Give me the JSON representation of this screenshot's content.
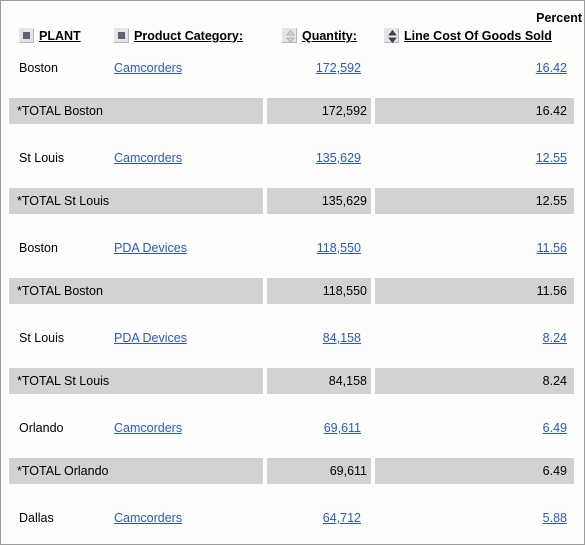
{
  "header": {
    "percent_prefix": "Percent",
    "columns": [
      {
        "label": "PLANT",
        "icon": "group-square-icon",
        "icon_type": "square"
      },
      {
        "label": "Product Category:",
        "icon": "group-square-icon",
        "icon_type": "square"
      },
      {
        "label": "Quantity:",
        "icon": "sort-updown-icon",
        "icon_type": "sort-light"
      },
      {
        "label": "Line Cost Of Goods Sold",
        "icon": "sort-updown-icon",
        "icon_type": "sort-dark"
      }
    ]
  },
  "rows": [
    {
      "type": "detail",
      "plant": "Boston",
      "category": "Camcorders",
      "quantity": "172,592",
      "percent": "16.42"
    },
    {
      "type": "total",
      "label": "*TOTAL Boston",
      "quantity": "172,592",
      "percent": "16.42"
    },
    {
      "type": "detail",
      "plant": "St Louis",
      "category": "Camcorders",
      "quantity": "135,629",
      "percent": "12.55"
    },
    {
      "type": "total",
      "label": "*TOTAL St Louis",
      "quantity": "135,629",
      "percent": "12.55"
    },
    {
      "type": "detail",
      "plant": "Boston",
      "category": "PDA Devices",
      "quantity": "118,550",
      "percent": "11.56"
    },
    {
      "type": "total",
      "label": "*TOTAL Boston",
      "quantity": "118,550",
      "percent": "11.56"
    },
    {
      "type": "detail",
      "plant": "St Louis",
      "category": "PDA Devices",
      "quantity": "84,158",
      "percent": "8.24"
    },
    {
      "type": "total",
      "label": "*TOTAL St Louis",
      "quantity": "84,158",
      "percent": "8.24"
    },
    {
      "type": "detail",
      "plant": "Orlando",
      "category": "Camcorders",
      "quantity": "69,611",
      "percent": "6.49"
    },
    {
      "type": "total",
      "label": "*TOTAL Orlando",
      "quantity": "69,611",
      "percent": "6.49"
    },
    {
      "type": "detail",
      "plant": "Dallas",
      "category": "Camcorders",
      "quantity": "64,712",
      "percent": "5.88"
    }
  ],
  "colors": {
    "link": "#2b59c3",
    "total_band": "#d2d2d2",
    "page_background": "#fdfdfb",
    "border": "#9b9b9b",
    "icon_glyph": "#5a6472"
  }
}
